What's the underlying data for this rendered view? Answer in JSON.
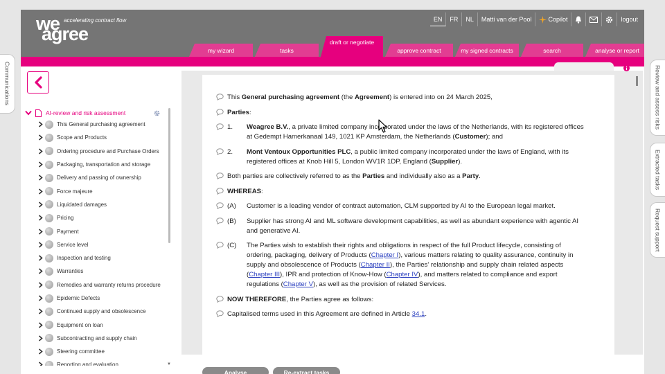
{
  "logo": {
    "we": "we",
    "agree": "agree",
    "tagline": "accelerating contract flow"
  },
  "topbar": {
    "languages": [
      "EN",
      "FR",
      "NL"
    ],
    "active_language": "EN",
    "user": "Matti van der Pool",
    "copilot": "Copilot",
    "logout": "logout"
  },
  "nav": {
    "tabs": [
      "my wizard",
      "tasks",
      "draft or negotiate",
      "approve contract",
      "my signed contracts",
      "search",
      "analyse or report"
    ],
    "active": "draft or negotiate"
  },
  "side_tabs": {
    "left": "Communications",
    "right": [
      "Review and assess risks",
      "Extracted tasks",
      "Request support"
    ]
  },
  "tree": {
    "root": "AI-review and risk assessment",
    "items": [
      "This General purchasing agreement",
      "Scope and Products",
      "Ordering procedure and Purchase Orders",
      "Packaging, transportation and storage",
      "Delivery and passing of ownership",
      "Force majeure",
      "Liquidated damages",
      "Pricing",
      "Payment",
      "Service level",
      "Inspection and testing",
      "Warranties",
      "Remedies and warranty returns procedure",
      "Epidemic Defects",
      "Continued supply and obsolescence",
      "Equipment on loan",
      "Subcontracting and supply chain",
      "Steering committee",
      "Reporting and evaluation"
    ]
  },
  "document": {
    "p1": {
      "a": "This ",
      "b": "General purchasing agreement",
      "c": " (the ",
      "d": "Agreement",
      "e": ") is entered into on 24 March 2025,"
    },
    "parties_heading": "Parties",
    "party1": {
      "num": "1.",
      "name": "Weagree B.V.",
      "text": ", a private limited company incorporated under the laws of the Netherlands, with its registered offices at Gedempt Hamerkanaal 149, 1021 KP Amsterdam, the Netherlands (",
      "role": "Customer",
      "end": "); and"
    },
    "party2": {
      "num": "2.",
      "name": "Mont Ventoux Opportunities PLC",
      "text": ", a public limited company incorporated under the laws of England, with its registered offices at Knob Hill 5, London WV1R 1DP, England (",
      "role": "Supplier",
      "end": ")."
    },
    "both": {
      "a": "Both parties are collectively referred to as the ",
      "b": "Parties",
      "c": " and individually also as a ",
      "d": "Party",
      "e": "."
    },
    "whereas": "WHEREAS",
    "recital_a": {
      "num": "(A)",
      "text": "Customer is a leading vendor of contract automation, CLM supported by AI to the European legal market."
    },
    "recital_b": {
      "num": "(B)",
      "text": "Supplier has strong AI and ML software development capabilities, as well as abundant experience with agentic AI and generative AI."
    },
    "recital_c": {
      "num": "(C)",
      "t1": "The Parties wish to establish their rights and obligations in respect of the full Product lifecycle, consisting of ordering, packaging, delivery of Products (",
      "l1": "Chapter I",
      "t2": "), various matters relating to quality assurance, continuity in supply and obsolescence of Products (",
      "l2": "Chapter II",
      "t3": "), the Parties' relationship and supply chain related aspects (",
      "l3": "Chapter III",
      "t4": "), IPR and protection of Know-How (",
      "l4": "Chapter IV",
      "t5": "), and matters related to compliance and export regulations (",
      "l5": "Chapter V",
      "t6": "), as well as the provision of related Services."
    },
    "now_therefore": {
      "a": "NOW THEREFORE",
      "b": ", the Parties agree as follows:"
    },
    "capitalised": {
      "a": "Capitalised terms used in this Agreement are defined in Article ",
      "link": "34.1",
      "b": "."
    }
  },
  "buttons": {
    "analyse": "Analyse",
    "reextract": "Re-extract tasks"
  },
  "colors": {
    "brand": "#e6007e",
    "header": "#757575"
  }
}
